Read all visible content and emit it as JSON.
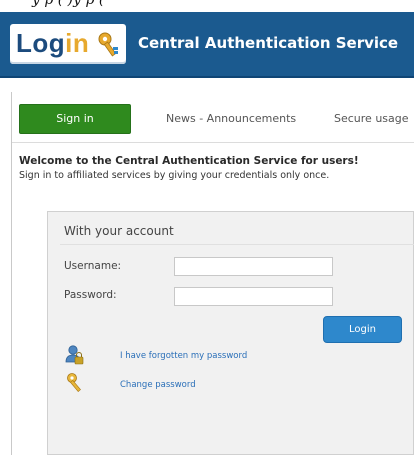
{
  "top_strip_text": "y    p          (   )y  p  (",
  "header": {
    "logo_main": "Login",
    "title": "Central Authentication Service",
    "brand_color": "#1b5a8f",
    "logo_accent_color": "#e7a92e",
    "logo_icon": "key-icon"
  },
  "tabs": [
    {
      "label": "Sign in",
      "active": true
    },
    {
      "label": "News - Announcements",
      "active": false
    },
    {
      "label": "Secure usage",
      "active": false
    }
  ],
  "intro": {
    "heading": "Welcome to the Central Authentication Service for users!",
    "text": "Sign in to affiliated services by giving your credentials only once."
  },
  "login_panel": {
    "title": "With your account",
    "username_label": "Username:",
    "username_value": "",
    "password_label": "Password:",
    "password_value": "",
    "submit_label": "Login",
    "submit_color": "#2e88cc",
    "links": [
      {
        "label": "I have forgotten my password",
        "icon": "lock-person-icon"
      },
      {
        "label": "Change password",
        "icon": "key-icon"
      }
    ]
  },
  "active_tab_color": "#2f8a1e"
}
